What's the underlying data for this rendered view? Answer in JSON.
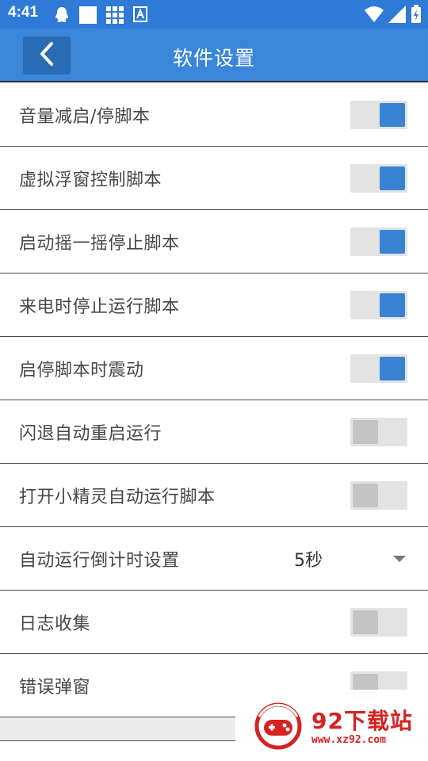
{
  "status_bar": {
    "time": "4:41",
    "left_icons": [
      "qq-icon",
      "square-icon",
      "grid-icon",
      "a-icon"
    ],
    "right_icons": [
      "wifi-icon",
      "signal-icon",
      "battery-icon"
    ]
  },
  "app_bar": {
    "title": "软件设置"
  },
  "settings": [
    {
      "label": "音量减启/停脚本",
      "type": "toggle",
      "on": true
    },
    {
      "label": "虚拟浮窗控制脚本",
      "type": "toggle",
      "on": true
    },
    {
      "label": "启动摇一摇停止脚本",
      "type": "toggle",
      "on": true
    },
    {
      "label": "来电时停止运行脚本",
      "type": "toggle",
      "on": true
    },
    {
      "label": "启停脚本时震动",
      "type": "toggle",
      "on": true
    },
    {
      "label": "闪退自动重启运行",
      "type": "toggle",
      "on": false
    },
    {
      "label": "打开小精灵自动运行脚本",
      "type": "toggle",
      "on": false
    },
    {
      "label": "自动运行倒计时设置",
      "type": "select",
      "value": "5秒"
    },
    {
      "label": "日志收集",
      "type": "toggle",
      "on": false
    },
    {
      "label": "错误弹窗",
      "type": "toggle",
      "on": false
    }
  ],
  "watermark": {
    "text": "92下载站",
    "url": "www.xz92.com"
  },
  "colors": {
    "status_bar": "#2f7ad6",
    "app_bar": "#3a86d9",
    "toggle_on": "#3a83d4",
    "toggle_off": "#c4c4c4",
    "watermark": "#d72222"
  }
}
